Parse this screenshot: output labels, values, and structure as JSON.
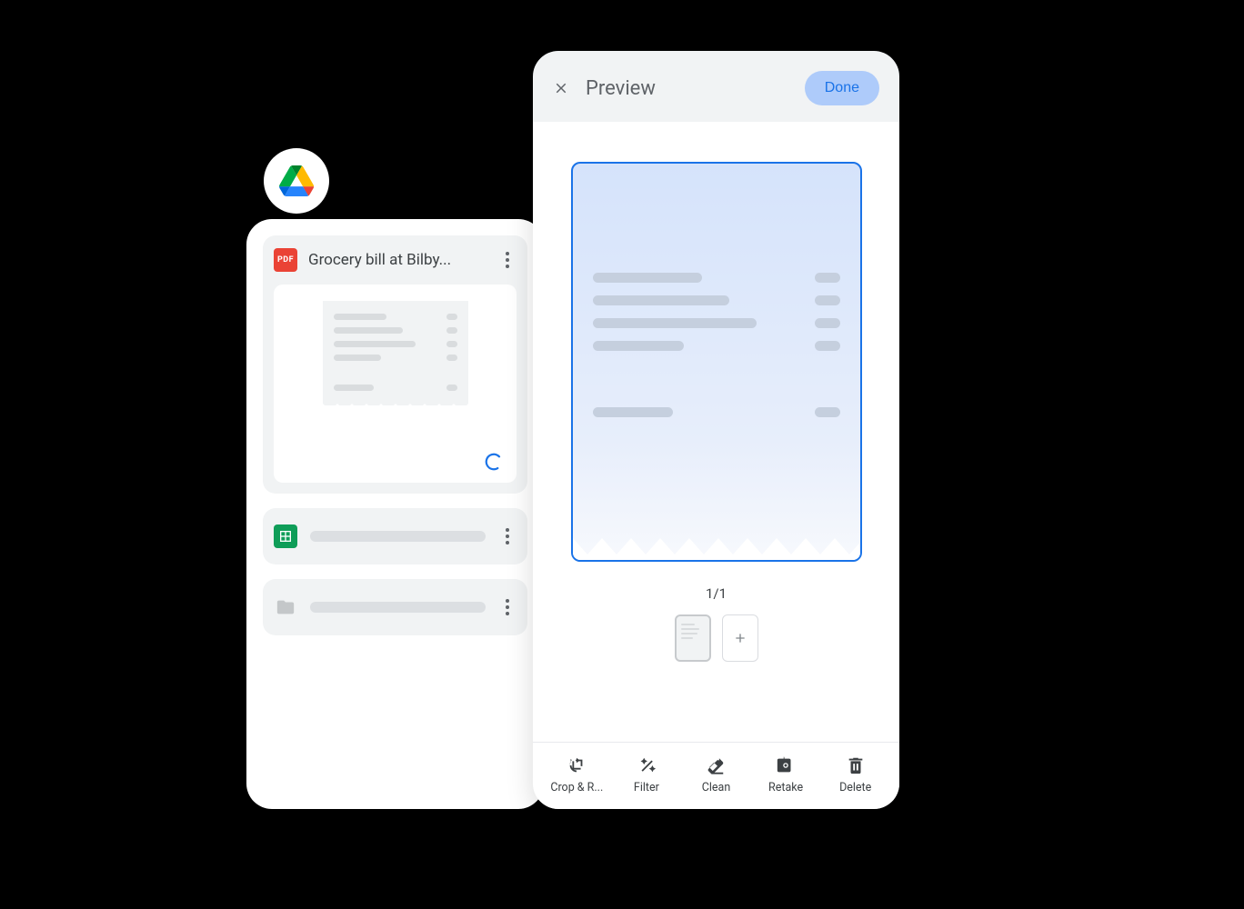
{
  "drive": {
    "pdf_badge": "PDF",
    "file_title": "Grocery bill at Bilby..."
  },
  "preview": {
    "title": "Preview",
    "done": "Done",
    "page_counter": "1/1",
    "toolbar": {
      "crop": "Crop & R...",
      "filter": "Filter",
      "clean": "Clean",
      "retake": "Retake",
      "delete": "Delete"
    }
  }
}
